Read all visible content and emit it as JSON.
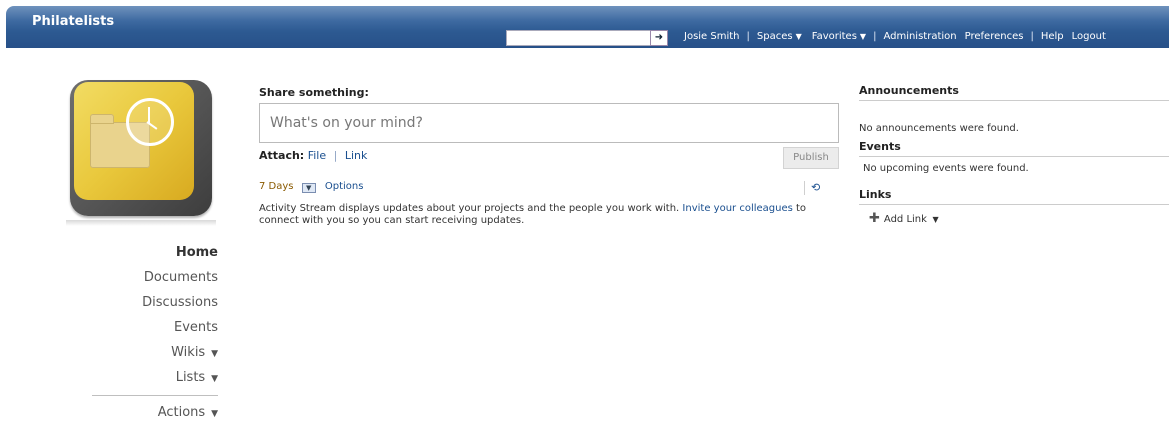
{
  "app": {
    "title": "Philatelists"
  },
  "search": {
    "placeholder": "",
    "go_icon": "arrow-right-icon"
  },
  "nav": {
    "user": "Josie Smith",
    "spaces": "Spaces",
    "favorites": "Favorites",
    "administration": "Administration",
    "preferences": "Preferences",
    "help": "Help",
    "logout": "Logout"
  },
  "sidebar": {
    "items": [
      {
        "label": "Home",
        "active": true
      },
      {
        "label": "Documents"
      },
      {
        "label": "Discussions"
      },
      {
        "label": "Events"
      },
      {
        "label": "Wikis"
      },
      {
        "label": "Lists"
      }
    ],
    "actions": "Actions"
  },
  "share": {
    "label": "Share something:",
    "placeholder": "What's on your mind?",
    "attach_label": "Attach:",
    "attach_file": "File",
    "attach_link": "Link",
    "publish": "Publish"
  },
  "stream": {
    "days": "7 Days",
    "options": "Options",
    "info_prefix": "Activity Stream displays updates about your projects and the people you work with.",
    "invite": "Invite your colleagues",
    "info_suffix": "to connect with you so you can start receiving updates."
  },
  "right": {
    "announcements_title": "Announcements",
    "announcements_empty": "No announcements were found.",
    "events_title": "Events",
    "events_empty": "No upcoming events were found.",
    "links_title": "Links",
    "add_link": "Add Link"
  },
  "colors": {
    "header": "#2d5a92",
    "link": "#1a4f8f",
    "days": "#8a5a00"
  }
}
